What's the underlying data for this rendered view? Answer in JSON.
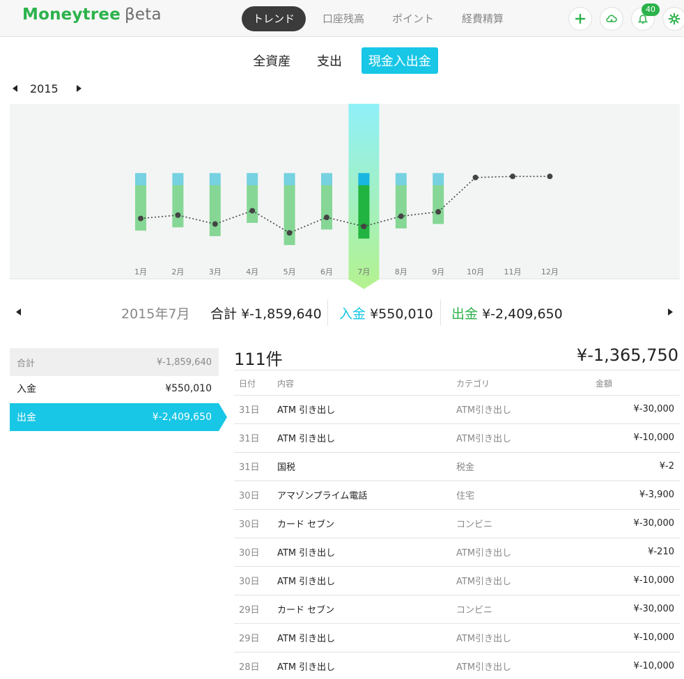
{
  "header": {
    "logo": "Moneytree",
    "beta": "βeta",
    "tabs": [
      {
        "label": "トレンド",
        "active": true
      },
      {
        "label": "口座残高",
        "active": false
      },
      {
        "label": "ポイント",
        "active": false
      },
      {
        "label": "経費精算",
        "active": false
      }
    ],
    "buttons": [
      {
        "name": "add-button",
        "icon": "plus-icon"
      },
      {
        "name": "cloud-sync-button",
        "icon": "cloud-icon"
      },
      {
        "name": "notification-button",
        "icon": "bell-icon"
      },
      {
        "name": "settings-button",
        "icon": "gear-icon"
      }
    ],
    "notification_count": "40"
  },
  "subtabs": [
    {
      "label": "全資産",
      "active": false
    },
    {
      "label": "支出",
      "active": false
    },
    {
      "label": "現金入出金",
      "active": true
    }
  ],
  "year": "2015",
  "chart_data": {
    "type": "bar",
    "categories": [
      "1月",
      "2月",
      "3月",
      "4月",
      "5月",
      "6月",
      "7月",
      "8月",
      "9月",
      "10月",
      "11月",
      "12月"
    ],
    "selected": "7月",
    "series": [
      {
        "values": [
          550000,
          550000,
          550000,
          550000,
          550000,
          550000,
          550010,
          550000,
          550000,
          null,
          null,
          null
        ]
      },
      {
        "values": [
          -2050000,
          -1900000,
          -2300000,
          -1700000,
          -2700000,
          -2000000,
          -2409650,
          -1950000,
          -1750000,
          null,
          null,
          null
        ]
      },
      {
        "values": [
          -1500000,
          -1350000,
          -1750000,
          -1150000,
          -2150000,
          -1450000,
          -1859640,
          -1400000,
          -1200000,
          350000,
          400000,
          400000
        ]
      }
    ],
    "colors": {
      "inflow": "#76d1e0",
      "outflow": "#86d796",
      "selected_inflow": "#18b6e0",
      "selected_outflow": "#22b440",
      "line": "#444444",
      "highlight_top": "#8ff0f8",
      "highlight_bottom": "#b4f18f"
    }
  },
  "month_summary": {
    "period": "2015年7月",
    "total_label": "合計",
    "total_value": "¥-1,859,640",
    "in_label": "入金",
    "in_value": "¥550,010",
    "out_label": "出金",
    "out_value": "¥-2,409,650"
  },
  "left_panel": [
    {
      "label": "合計",
      "value": "¥-1,859,640"
    },
    {
      "label": "入金",
      "value": "¥550,010"
    },
    {
      "label": "出金",
      "value": "¥-2,409,650"
    }
  ],
  "list": {
    "count": "111件",
    "total": "¥-1,365,750",
    "columns": [
      "日付",
      "内容",
      "カテゴリ",
      "金額"
    ],
    "rows": [
      {
        "date": "31日",
        "desc": "ATM 引き出し",
        "category": "ATM引き出し",
        "amount": "¥-30,000"
      },
      {
        "date": "31日",
        "desc": "ATM 引き出し",
        "category": "ATM引き出し",
        "amount": "¥-10,000"
      },
      {
        "date": "31日",
        "desc": "国税",
        "category": "税金",
        "amount": "¥-2"
      },
      {
        "date": "30日",
        "desc": "アマゾンプライム電話",
        "category": "住宅",
        "amount": "¥-3,900"
      },
      {
        "date": "30日",
        "desc": "カード セブン",
        "category": "コンビニ",
        "amount": "¥-30,000"
      },
      {
        "date": "30日",
        "desc": "ATM 引き出し",
        "category": "ATM引き出し",
        "amount": "¥-210"
      },
      {
        "date": "30日",
        "desc": "ATM 引き出し",
        "category": "ATM引き出し",
        "amount": "¥-10,000"
      },
      {
        "date": "29日",
        "desc": "カード セブン",
        "category": "コンビニ",
        "amount": "¥-30,000"
      },
      {
        "date": "29日",
        "desc": "ATM 引き出し",
        "category": "ATM引き出し",
        "amount": "¥-10,000"
      },
      {
        "date": "28日",
        "desc": "ATM 引き出し",
        "category": "ATM引き出し",
        "amount": "¥-10,000"
      }
    ]
  }
}
